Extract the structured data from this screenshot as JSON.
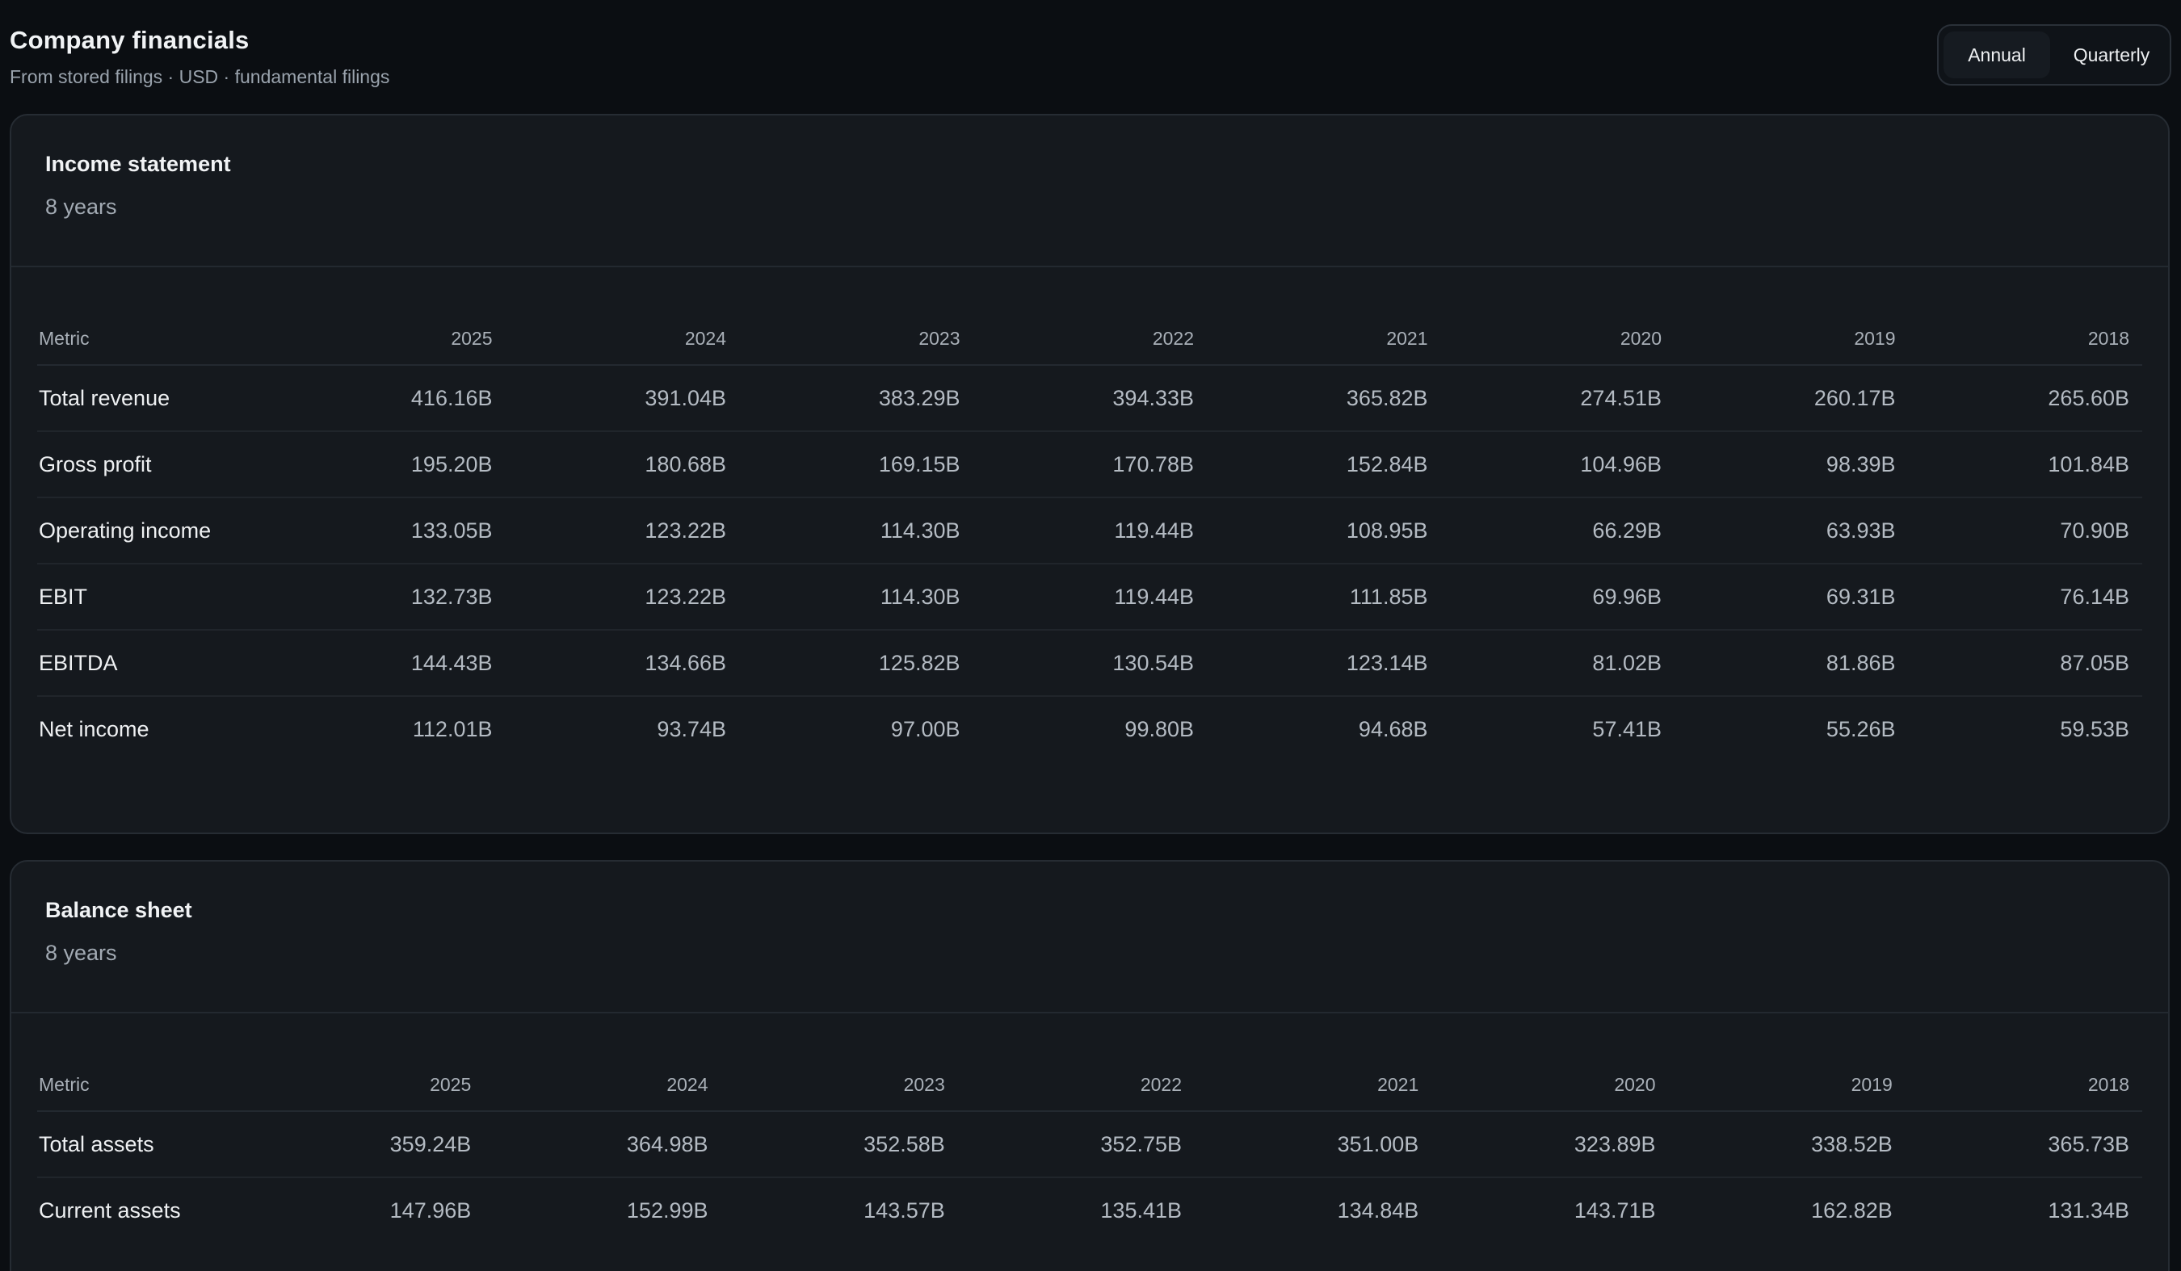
{
  "header": {
    "title": "Company financials",
    "subtitle": "From stored filings · USD · fundamental filings"
  },
  "toggle": {
    "annual": "Annual",
    "quarterly": "Quarterly",
    "selected": "Annual"
  },
  "income": {
    "title": "Income statement",
    "meta": "8 years",
    "columns": [
      "Metric",
      "2025",
      "2024",
      "2023",
      "2022",
      "2021",
      "2020",
      "2019",
      "2018"
    ],
    "rows": [
      {
        "metric": "Total revenue",
        "values": [
          "416.16B",
          "391.04B",
          "383.29B",
          "394.33B",
          "365.82B",
          "274.51B",
          "260.17B",
          "265.60B"
        ]
      },
      {
        "metric": "Gross profit",
        "values": [
          "195.20B",
          "180.68B",
          "169.15B",
          "170.78B",
          "152.84B",
          "104.96B",
          "98.39B",
          "101.84B"
        ]
      },
      {
        "metric": "Operating income",
        "values": [
          "133.05B",
          "123.22B",
          "114.30B",
          "119.44B",
          "108.95B",
          "66.29B",
          "63.93B",
          "70.90B"
        ]
      },
      {
        "metric": "EBIT",
        "values": [
          "132.73B",
          "123.22B",
          "114.30B",
          "119.44B",
          "111.85B",
          "69.96B",
          "69.31B",
          "76.14B"
        ]
      },
      {
        "metric": "EBITDA",
        "values": [
          "144.43B",
          "134.66B",
          "125.82B",
          "130.54B",
          "123.14B",
          "81.02B",
          "81.86B",
          "87.05B"
        ]
      },
      {
        "metric": "Net income",
        "values": [
          "112.01B",
          "93.74B",
          "97.00B",
          "99.80B",
          "94.68B",
          "57.41B",
          "55.26B",
          "59.53B"
        ]
      }
    ]
  },
  "balance": {
    "title": "Balance sheet",
    "meta": "8 years",
    "columns": [
      "Metric",
      "2025",
      "2024",
      "2023",
      "2022",
      "2021",
      "2020",
      "2019",
      "2018"
    ],
    "rows": [
      {
        "metric": "Total assets",
        "values": [
          "359.24B",
          "364.98B",
          "352.58B",
          "352.75B",
          "351.00B",
          "323.89B",
          "338.52B",
          "365.73B"
        ]
      },
      {
        "metric": "Current assets",
        "values": [
          "147.96B",
          "152.99B",
          "143.57B",
          "135.41B",
          "134.84B",
          "143.71B",
          "162.82B",
          "131.34B"
        ]
      }
    ]
  },
  "colors": {
    "background": "#0b0e12",
    "card": "#15191e",
    "border": "#262c33",
    "text": "#eef0f2",
    "muted": "#a2aab3"
  }
}
